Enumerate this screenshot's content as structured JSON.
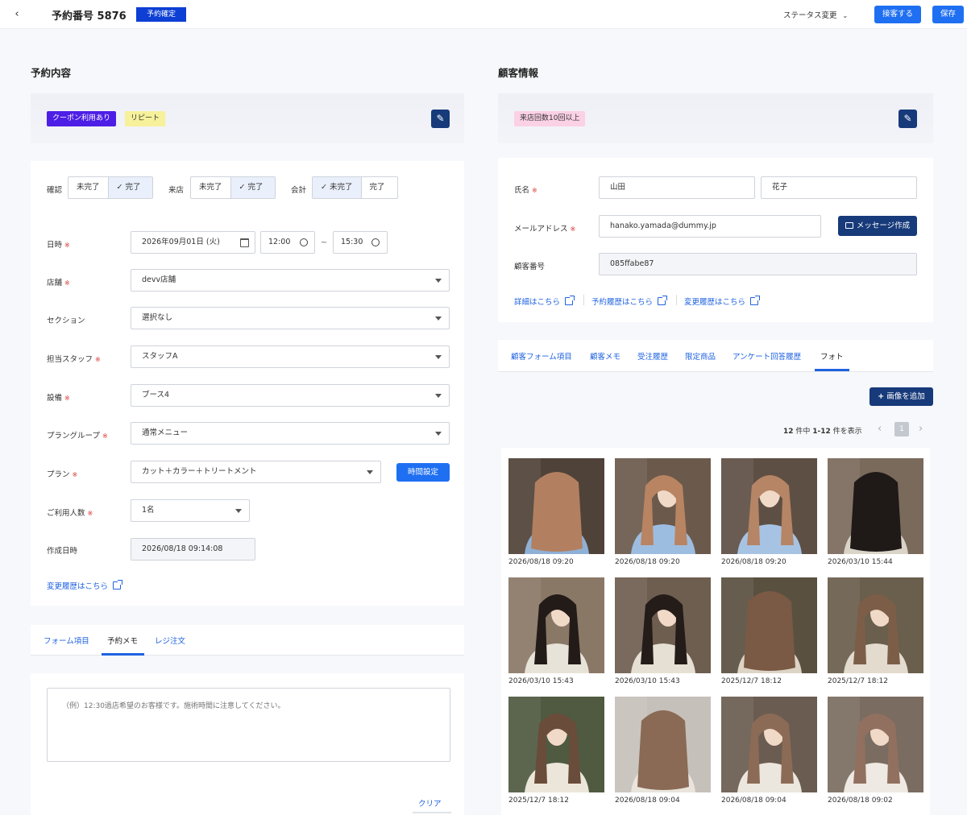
{
  "header": {
    "back_icon": "chevron-left-icon",
    "title": "予約番号 5876",
    "status_badge": "予約確定",
    "status_change": "ステータス変更",
    "checkout_button": "接客する",
    "save_button": "保存"
  },
  "reservation": {
    "section_title": "予約内容",
    "tags": [
      "クーポン利用あり",
      "リピート"
    ],
    "confirm_label": "確認",
    "visit_label": "来店",
    "payment_label": "会計",
    "incomplete": "未完了",
    "complete": "完了",
    "confirm_selected": "完了",
    "visit_selected": "完了",
    "payment_selected": "未完了",
    "datetime_label": "日時",
    "date_value": "2026年09月01日 (火)",
    "time_start": "12:00",
    "time_sep": "~",
    "time_end": "15:30",
    "store_label": "店舗",
    "store_value": "devv店舗",
    "section_label": "セクション",
    "section_value": "選択なし",
    "staff_label": "担当スタッフ",
    "staff_value": "スタッフA",
    "equipment_label": "設備",
    "equipment_value": "ブース4",
    "plan_group_label": "プラングループ",
    "plan_group_value": "通常メニュー",
    "plan_label": "プラン",
    "plan_value": "カット＋カラー＋トリートメント",
    "time_setting_button": "時間設定",
    "people_label": "ご利用人数",
    "people_value": "1名",
    "created_label": "作成日時",
    "created_value": "2026/08/18 09:14:08",
    "history_link": "変更履歴はこちら",
    "required_mark": "※",
    "tabs": [
      "フォーム項目",
      "予約メモ",
      "レジ注文"
    ],
    "active_tab": "予約メモ",
    "memo_placeholder": "（例）12:30過店希望のお客様です。施術時間に注意してください。",
    "clear_button": "クリア"
  },
  "customer": {
    "section_title": "顧客情報",
    "tags": [
      "来店回数10回以上"
    ],
    "name_label": "氏名",
    "last_name": "山田",
    "first_name": "花子",
    "email_label": "メールアドレス",
    "email_value": "hanako.yamada@dummy.jp",
    "message_button": "メッセージ作成",
    "number_label": "顧客番号",
    "number_value": "085ffabe87",
    "links": [
      "詳細はこちら",
      "予約履歴はこちら",
      "変更履歴はこちら"
    ],
    "tabs": [
      "顧客フォーム項目",
      "顧客メモ",
      "受注履歴",
      "限定商品",
      "アンケート回答履歴",
      "フォト"
    ],
    "active_tab": "フォト",
    "add_image_button": "画像を追加",
    "pagination_text_count": "12",
    "pagination_text_mid": " 件中 ",
    "pagination_text_range": "1-12",
    "pagination_text_end": " 件を表示",
    "current_page": "1",
    "photos": [
      {
        "date": "2026/08/18 09:20",
        "hair": "#b28060",
        "bg": "#4f4238",
        "shirt": "#8fb0d6",
        "view": "back"
      },
      {
        "date": "2026/08/18 09:20",
        "hair": "#b88462",
        "bg": "#6b5a4c",
        "shirt": "#9dbde0",
        "view": "side"
      },
      {
        "date": "2026/08/18 09:20",
        "hair": "#b58566",
        "bg": "#5e4f44",
        "shirt": "#a7c3e3",
        "view": "front"
      },
      {
        "date": "2026/03/10 15:44",
        "hair": "#1f1a18",
        "bg": "#7a6a5c",
        "shirt": "#d9d3c8",
        "view": "back"
      },
      {
        "date": "2026/03/10 15:43",
        "hair": "#231b18",
        "bg": "#8a7866",
        "shirt": "#e8e3d8",
        "view": "side"
      },
      {
        "date": "2026/03/10 15:43",
        "hair": "#241c19",
        "bg": "#6e5e50",
        "shirt": "#e6e0d4",
        "view": "side"
      },
      {
        "date": "2025/12/7 18:12",
        "hair": "#7a5a44",
        "bg": "#5a5040",
        "shirt": "#ddd4c6",
        "view": "back"
      },
      {
        "date": "2025/12/7 18:12",
        "hair": "#7c5e48",
        "bg": "#6a5e4c",
        "shirt": "#e3dbcd",
        "view": "side"
      },
      {
        "date": "2025/12/7 18:12",
        "hair": "#6a4c3a",
        "bg": "#4f5a40",
        "shirt": "#ece6da",
        "view": "front"
      },
      {
        "date": "2026/08/18 09:04",
        "hair": "#8a6a55",
        "bg": "#c6c0ba",
        "shirt": "#e9e4dc",
        "view": "back"
      },
      {
        "date": "2026/08/18 09:04",
        "hair": "#8c6b56",
        "bg": "#6a5c50",
        "shirt": "#ebe6de",
        "view": "side"
      },
      {
        "date": "2026/08/18 09:02",
        "hair": "#917060",
        "bg": "#7a6c60",
        "shirt": "#eee9e2",
        "view": "side"
      }
    ]
  },
  "colors": {
    "primary": "#1f6ff2",
    "badge": "#0d3fd4",
    "edit_button": "#173a7a",
    "coupon_tag": "#4d1fe6",
    "repeat_tag": "#f6f19a",
    "visits_tag": "#fbd1e6",
    "required": "#d6332e"
  }
}
